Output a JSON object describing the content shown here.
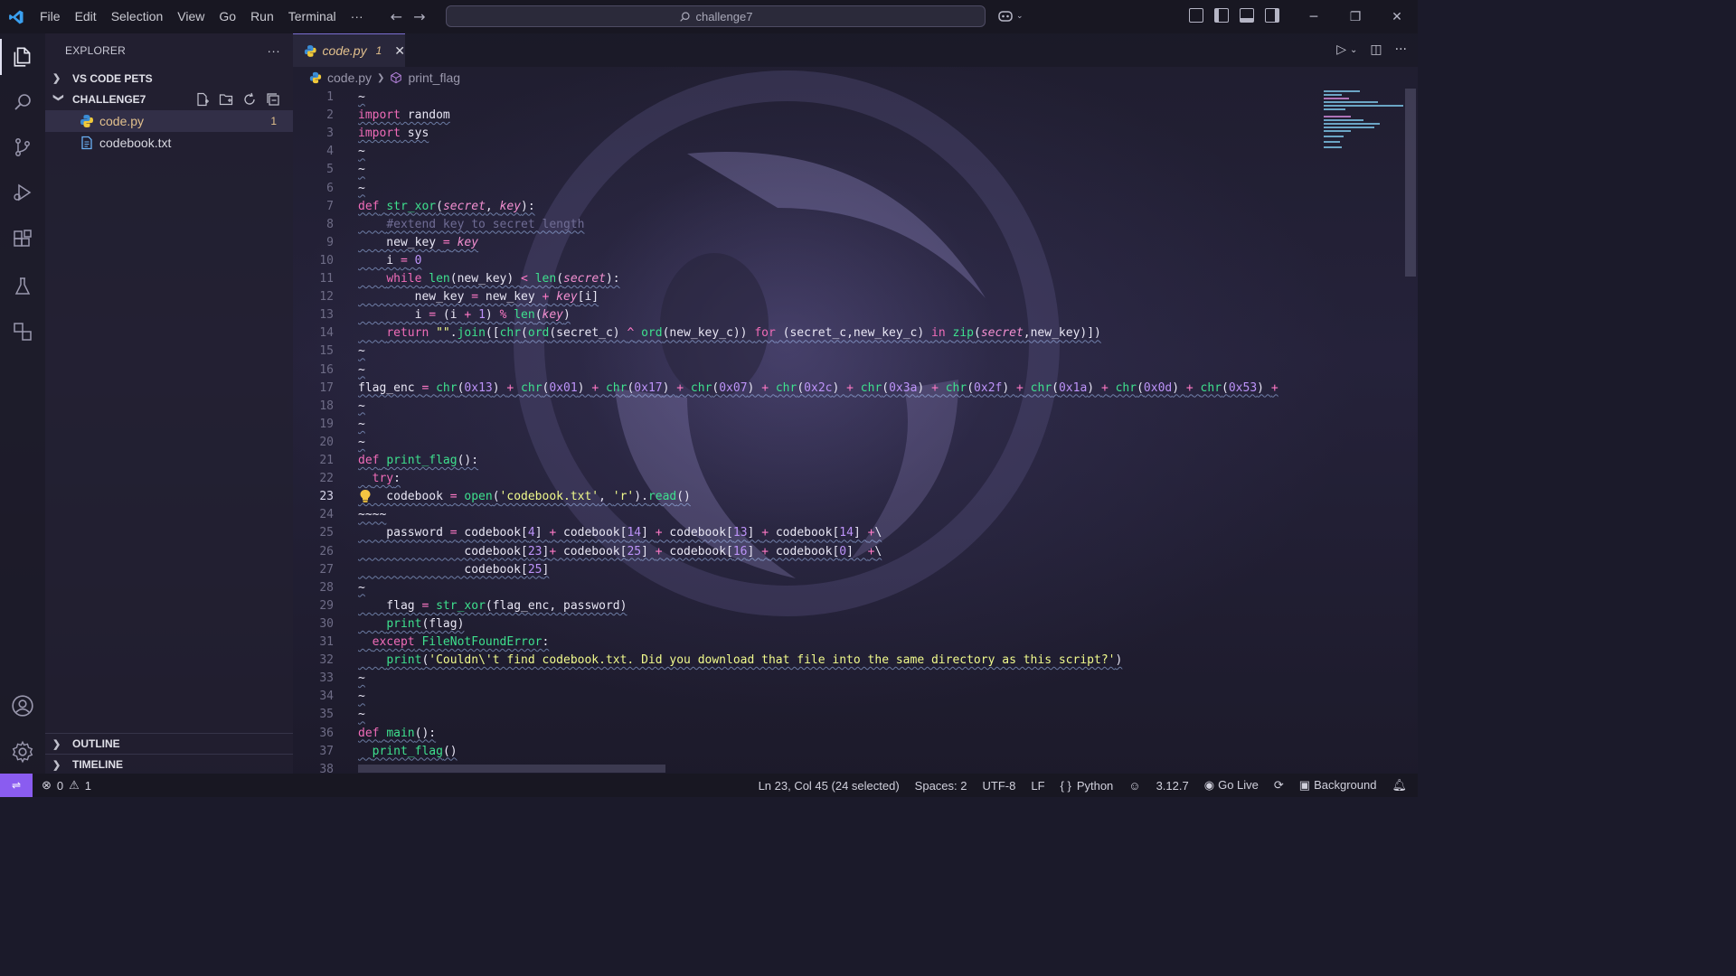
{
  "window": {
    "menu": [
      "File",
      "Edit",
      "Selection",
      "View",
      "Go",
      "Run",
      "Terminal",
      "···"
    ],
    "search_text": "challenge7"
  },
  "sidebar": {
    "title": "EXPLORER",
    "more": "···",
    "sections": {
      "vs_code_pets": "VS CODE PETS",
      "project": "CHALLENGE7",
      "outline": "OUTLINE",
      "timeline": "TIMELINE"
    },
    "files": [
      {
        "name": "code.py",
        "badge": "1",
        "icon": "python-file-icon"
      },
      {
        "name": "codebook.txt",
        "badge": "",
        "icon": "text-file-icon"
      }
    ]
  },
  "editor": {
    "tab": {
      "name": "code.py",
      "problems": "1"
    },
    "breadcrumb": {
      "file": "code.py",
      "symbol": "print_flag"
    },
    "current_line": 23,
    "line_numbers": [
      "1",
      "2",
      "3",
      "4",
      "5",
      "6",
      "7",
      "8",
      "9",
      "10",
      "11",
      "12",
      "13",
      "14",
      "15",
      "16",
      "17",
      "18",
      "19",
      "20",
      "21",
      "22",
      "23",
      "24",
      "25",
      "26",
      "27",
      "28",
      "29",
      "30",
      "31",
      "32",
      "33",
      "34",
      "35",
      "36",
      "37",
      "38"
    ],
    "lines": [
      [
        [
          "~",
          "vr"
        ]
      ],
      [
        [
          "import",
          "kw"
        ],
        [
          " random",
          "vr"
        ]
      ],
      [
        [
          "import",
          "kw"
        ],
        [
          " sys",
          "vr"
        ]
      ],
      [
        [
          "~",
          "vr"
        ]
      ],
      [
        [
          "~",
          "vr"
        ]
      ],
      [
        [
          "~",
          "vr"
        ]
      ],
      [
        [
          "def",
          "kw"
        ],
        [
          " ",
          "vr"
        ],
        [
          "str_xor",
          "fn"
        ],
        [
          "(",
          "pn"
        ],
        [
          "secret",
          "pm"
        ],
        [
          ", ",
          "pn"
        ],
        [
          "key",
          "pm"
        ],
        [
          "):",
          "pn"
        ]
      ],
      [
        [
          "    ",
          "vr"
        ],
        [
          "#extend key to secret length",
          "cm"
        ]
      ],
      [
        [
          "    new_key ",
          "vr"
        ],
        [
          "=",
          "op"
        ],
        [
          " ",
          "vr"
        ],
        [
          "key",
          "pm"
        ]
      ],
      [
        [
          "    i ",
          "vr"
        ],
        [
          "=",
          "op"
        ],
        [
          " ",
          "vr"
        ],
        [
          "0",
          "nm"
        ]
      ],
      [
        [
          "    ",
          "vr"
        ],
        [
          "while",
          "kw"
        ],
        [
          " ",
          "vr"
        ],
        [
          "len",
          "fn"
        ],
        [
          "(new_key) ",
          "pn"
        ],
        [
          "<",
          "op"
        ],
        [
          " ",
          "vr"
        ],
        [
          "len",
          "fn"
        ],
        [
          "(",
          "pn"
        ],
        [
          "secret",
          "pm"
        ],
        [
          "):",
          "pn"
        ]
      ],
      [
        [
          "        new_key ",
          "vr"
        ],
        [
          "=",
          "op"
        ],
        [
          " new_key ",
          "vr"
        ],
        [
          "+",
          "op"
        ],
        [
          " ",
          "vr"
        ],
        [
          "key",
          "pm"
        ],
        [
          "[i]",
          "pn"
        ]
      ],
      [
        [
          "        i ",
          "vr"
        ],
        [
          "=",
          "op"
        ],
        [
          " (i ",
          "vr"
        ],
        [
          "+",
          "op"
        ],
        [
          " ",
          "vr"
        ],
        [
          "1",
          "nm"
        ],
        [
          ") ",
          "pn"
        ],
        [
          "%",
          "op"
        ],
        [
          " ",
          "vr"
        ],
        [
          "len",
          "fn"
        ],
        [
          "(",
          "pn"
        ],
        [
          "key",
          "pm"
        ],
        [
          ")",
          "pn"
        ]
      ],
      [
        [
          "    ",
          "vr"
        ],
        [
          "return",
          "kw"
        ],
        [
          " ",
          "vr"
        ],
        [
          "\"\"",
          "st"
        ],
        [
          ".",
          "pn"
        ],
        [
          "join",
          "fn"
        ],
        [
          "([",
          "pn"
        ],
        [
          "chr",
          "fn"
        ],
        [
          "(",
          "pn"
        ],
        [
          "ord",
          "fn"
        ],
        [
          "(secret_c) ",
          "pn"
        ],
        [
          "^",
          "op"
        ],
        [
          " ",
          "vr"
        ],
        [
          "ord",
          "fn"
        ],
        [
          "(new_key_c)) ",
          "pn"
        ],
        [
          "for",
          "kw"
        ],
        [
          " (secret_c,new_key_c) ",
          "vr"
        ],
        [
          "in",
          "kw"
        ],
        [
          " ",
          "vr"
        ],
        [
          "zip",
          "fn"
        ],
        [
          "(",
          "pn"
        ],
        [
          "secret",
          "pm"
        ],
        [
          ",new_key)])",
          "pn"
        ]
      ],
      [
        [
          "~",
          "vr"
        ]
      ],
      [
        [
          "~",
          "vr"
        ]
      ],
      [
        [
          "flag_enc ",
          "vr"
        ],
        [
          "=",
          "op"
        ],
        [
          " ",
          "vr"
        ],
        [
          "chr",
          "fn"
        ],
        [
          "(",
          "pn"
        ],
        [
          "0x13",
          "nm"
        ],
        [
          ") ",
          "pn"
        ],
        [
          "+",
          "op"
        ],
        [
          " ",
          "vr"
        ],
        [
          "chr",
          "fn"
        ],
        [
          "(",
          "pn"
        ],
        [
          "0x01",
          "nm"
        ],
        [
          ") ",
          "pn"
        ],
        [
          "+",
          "op"
        ],
        [
          " ",
          "vr"
        ],
        [
          "chr",
          "fn"
        ],
        [
          "(",
          "pn"
        ],
        [
          "0x17",
          "nm"
        ],
        [
          ") ",
          "pn"
        ],
        [
          "+",
          "op"
        ],
        [
          " ",
          "vr"
        ],
        [
          "chr",
          "fn"
        ],
        [
          "(",
          "pn"
        ],
        [
          "0x07",
          "nm"
        ],
        [
          ") ",
          "pn"
        ],
        [
          "+",
          "op"
        ],
        [
          " ",
          "vr"
        ],
        [
          "chr",
          "fn"
        ],
        [
          "(",
          "pn"
        ],
        [
          "0x2c",
          "nm"
        ],
        [
          ") ",
          "pn"
        ],
        [
          "+",
          "op"
        ],
        [
          " ",
          "vr"
        ],
        [
          "chr",
          "fn"
        ],
        [
          "(",
          "pn"
        ],
        [
          "0x3a",
          "nm"
        ],
        [
          ") ",
          "pn"
        ],
        [
          "+",
          "op"
        ],
        [
          " ",
          "vr"
        ],
        [
          "chr",
          "fn"
        ],
        [
          "(",
          "pn"
        ],
        [
          "0x2f",
          "nm"
        ],
        [
          ") ",
          "pn"
        ],
        [
          "+",
          "op"
        ],
        [
          " ",
          "vr"
        ],
        [
          "chr",
          "fn"
        ],
        [
          "(",
          "pn"
        ],
        [
          "0x1a",
          "nm"
        ],
        [
          ") ",
          "pn"
        ],
        [
          "+",
          "op"
        ],
        [
          " ",
          "vr"
        ],
        [
          "chr",
          "fn"
        ],
        [
          "(",
          "pn"
        ],
        [
          "0x0d",
          "nm"
        ],
        [
          ") ",
          "pn"
        ],
        [
          "+",
          "op"
        ],
        [
          " ",
          "vr"
        ],
        [
          "chr",
          "fn"
        ],
        [
          "(",
          "pn"
        ],
        [
          "0x53",
          "nm"
        ],
        [
          ") ",
          "pn"
        ],
        [
          "+",
          "op"
        ]
      ],
      [
        [
          "~",
          "vr"
        ]
      ],
      [
        [
          "~",
          "vr"
        ]
      ],
      [
        [
          "~",
          "vr"
        ]
      ],
      [
        [
          "def",
          "kw"
        ],
        [
          " ",
          "vr"
        ],
        [
          "print_flag",
          "fn"
        ],
        [
          "():",
          "pn"
        ]
      ],
      [
        [
          "  ",
          "vr"
        ],
        [
          "try",
          "kw"
        ],
        [
          ":",
          "pn"
        ]
      ],
      [
        [
          "    codebook ",
          "vr"
        ],
        [
          "=",
          "op"
        ],
        [
          " ",
          "vr"
        ],
        [
          "open",
          "fn"
        ],
        [
          "(",
          "pn"
        ],
        [
          "'codebook.txt'",
          "st"
        ],
        [
          ", ",
          "pn"
        ],
        [
          "'r'",
          "st"
        ],
        [
          ").",
          "pn"
        ],
        [
          "read",
          "fn"
        ],
        [
          "()",
          "pn"
        ]
      ],
      [
        [
          "~~~~",
          "vr"
        ]
      ],
      [
        [
          "    password ",
          "vr"
        ],
        [
          "=",
          "op"
        ],
        [
          " codebook[",
          "vr"
        ],
        [
          "4",
          "nm"
        ],
        [
          "] ",
          "pn"
        ],
        [
          "+",
          "op"
        ],
        [
          " codebook[",
          "vr"
        ],
        [
          "14",
          "nm"
        ],
        [
          "] ",
          "pn"
        ],
        [
          "+",
          "op"
        ],
        [
          " codebook[",
          "vr"
        ],
        [
          "13",
          "nm"
        ],
        [
          "] ",
          "pn"
        ],
        [
          "+",
          "op"
        ],
        [
          " codebook[",
          "vr"
        ],
        [
          "14",
          "nm"
        ],
        [
          "] ",
          "pn"
        ],
        [
          "+",
          "op"
        ],
        [
          "\\",
          "pn"
        ]
      ],
      [
        [
          "               codebook[",
          "vr"
        ],
        [
          "23",
          "nm"
        ],
        [
          "]",
          "pn"
        ],
        [
          "+",
          "op"
        ],
        [
          " codebook[",
          "vr"
        ],
        [
          "25",
          "nm"
        ],
        [
          "] ",
          "pn"
        ],
        [
          "+",
          "op"
        ],
        [
          " codebook[",
          "vr"
        ],
        [
          "16",
          "nm"
        ],
        [
          "] ",
          "pn"
        ],
        [
          "+",
          "op"
        ],
        [
          " codebook[",
          "vr"
        ],
        [
          "0",
          "nm"
        ],
        [
          "]  ",
          "pn"
        ],
        [
          "+",
          "op"
        ],
        [
          "\\",
          "pn"
        ]
      ],
      [
        [
          "               codebook[",
          "vr"
        ],
        [
          "25",
          "nm"
        ],
        [
          "]",
          "pn"
        ]
      ],
      [
        [
          "~",
          "vr"
        ]
      ],
      [
        [
          "    flag ",
          "vr"
        ],
        [
          "=",
          "op"
        ],
        [
          " ",
          "vr"
        ],
        [
          "str_xor",
          "fn"
        ],
        [
          "(flag_enc, password)",
          "pn"
        ]
      ],
      [
        [
          "    ",
          "vr"
        ],
        [
          "print",
          "fn"
        ],
        [
          "(flag)",
          "pn"
        ]
      ],
      [
        [
          "  ",
          "vr"
        ],
        [
          "except",
          "kw"
        ],
        [
          " ",
          "vr"
        ],
        [
          "FileNotFoundError",
          "fn"
        ],
        [
          ":",
          "pn"
        ]
      ],
      [
        [
          "    ",
          "vr"
        ],
        [
          "print",
          "fn"
        ],
        [
          "(",
          "pn"
        ],
        [
          "'Couldn\\'t find codebook.txt. Did you download that file into the same directory as this script?'",
          "st"
        ],
        [
          ")",
          "pn"
        ]
      ],
      [
        [
          "~",
          "vr"
        ]
      ],
      [
        [
          "~",
          "vr"
        ]
      ],
      [
        [
          "~",
          "vr"
        ]
      ],
      [
        [
          "def",
          "kw"
        ],
        [
          " ",
          "vr"
        ],
        [
          "main",
          "fn"
        ],
        [
          "():",
          "pn"
        ]
      ],
      [
        [
          "  ",
          "vr"
        ],
        [
          "print_flag",
          "fn"
        ],
        [
          "()",
          "pn"
        ]
      ],
      [
        [
          "",
          "vr"
        ]
      ]
    ]
  },
  "statusbar": {
    "errors": "0",
    "warnings": "1",
    "cursor": "Ln 23, Col 45 (24 selected)",
    "spaces": "Spaces: 2",
    "encoding": "UTF-8",
    "eol": "LF",
    "language": "Python",
    "python_version": "3.12.7",
    "go_live": "Go Live",
    "background": "Background"
  },
  "colors": {
    "accent": "#8a5cf0",
    "keyword": "#f06cb8",
    "function": "#3ee08e",
    "string": "#f1fa8c",
    "number": "#bd93f9",
    "warning": "#e2c08d"
  }
}
